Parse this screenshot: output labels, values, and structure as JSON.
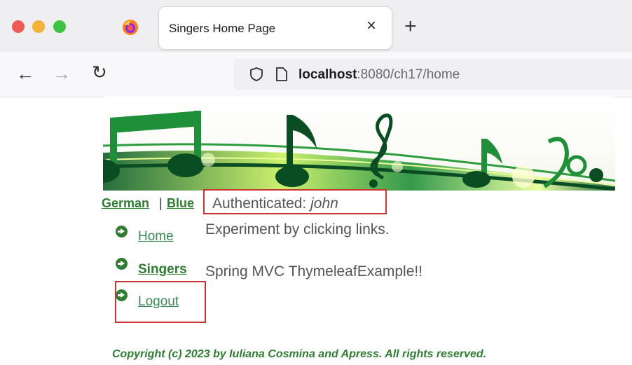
{
  "browser": {
    "tab_title": "Singers Home Page",
    "tab_close": "×",
    "new_tab": "+",
    "nav": {
      "back": "←",
      "forward": "→",
      "reload": "↻"
    },
    "url": {
      "host": "localhost",
      "rest": ":8080/ch17/home"
    }
  },
  "page": {
    "lang": {
      "german": "German",
      "separator": "|",
      "blue": "Blue"
    },
    "auth": {
      "label": "Authenticated: ",
      "user": "john"
    },
    "intro": "Experiment by clicking links.",
    "headline": "Spring MVC ThymeleafExample!!",
    "menu": [
      {
        "label": "Home"
      },
      {
        "label": "Singers"
      },
      {
        "label": "Logout"
      }
    ],
    "footer": "Copyright (c) 2023 by Iuliana Cosmina and Apress. All rights reserved."
  },
  "colors": {
    "link": "#2e7d32",
    "highlight_box": "#cc3333",
    "banner_green": "#1f8f3a"
  },
  "icons": [
    "firefox-icon",
    "shield-icon",
    "page-icon",
    "arrow-right-circle-icon"
  ]
}
